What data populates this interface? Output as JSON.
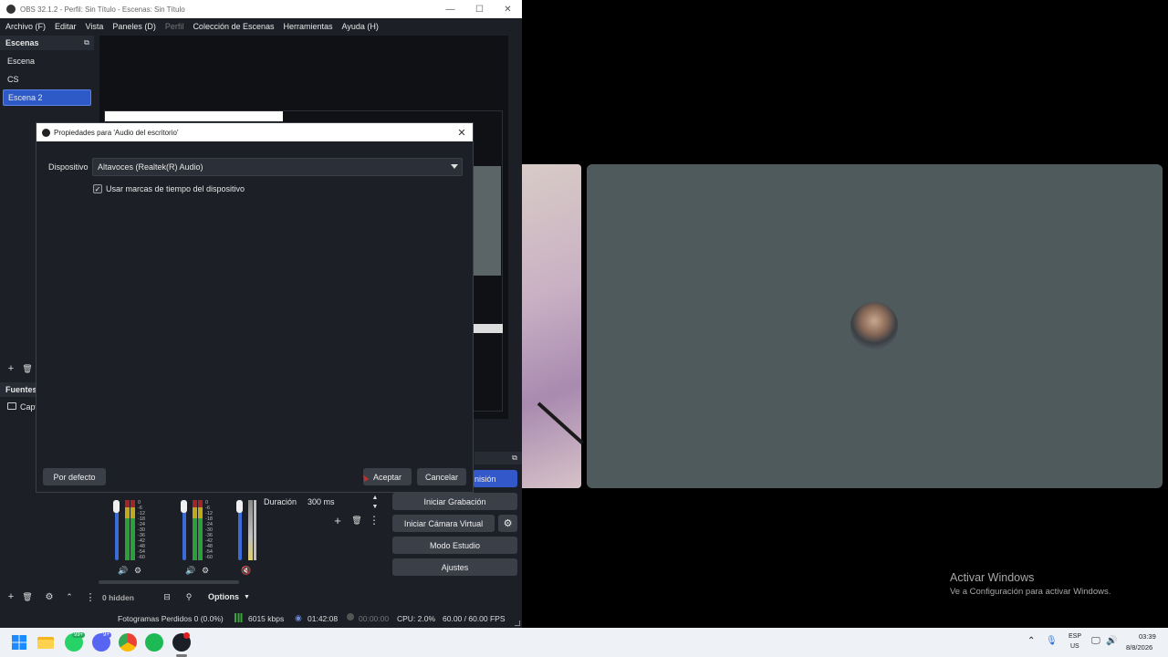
{
  "window": {
    "title": "OBS 32.1.2 - Perfil: Sin Título - Escenas: Sin Título",
    "minimize": "—",
    "maximize": "☐",
    "close": "✕"
  },
  "menu": [
    {
      "label": "Archivo (F)",
      "disabled": false
    },
    {
      "label": "Editar",
      "disabled": false
    },
    {
      "label": "Vista",
      "disabled": false
    },
    {
      "label": "Paneles (D)",
      "disabled": false
    },
    {
      "label": "Perfil",
      "disabled": true
    },
    {
      "label": "Colección de Escenas",
      "disabled": false
    },
    {
      "label": "Herramientas",
      "disabled": false
    },
    {
      "label": "Ayuda (H)",
      "disabled": false
    }
  ],
  "scenes": {
    "title": "Escenas",
    "items": [
      {
        "label": "Escena",
        "selected": false
      },
      {
        "label": "CS",
        "selected": false
      },
      {
        "label": "Escena 2",
        "selected": true
      }
    ]
  },
  "sources": {
    "title": "Fuentes",
    "first_item": "Capt"
  },
  "transitions": {
    "duration_label": "Duración",
    "duration_value": "300 ms"
  },
  "mixer": {
    "hidden_label": "0 hidden",
    "options_label": "Options",
    "db_ticks": [
      "0",
      "-6",
      "-12",
      "-18",
      "-24",
      "-30",
      "-36",
      "-42",
      "-48",
      "-54",
      "-60"
    ]
  },
  "controls": {
    "stream_partial": "nisión",
    "record": "Iniciar Grabación",
    "virtual_cam": "Iniciar Cámara Virtual",
    "studio_mode": "Modo Estudio",
    "settings": "Ajustes"
  },
  "status": {
    "dropped_frames": "Fotogramas Perdidos 0 (0.0%)",
    "bitrate": "6015 kbps",
    "stream_time": "01:42:08",
    "record_time": "00:00:00",
    "cpu": "CPU: 2.0%",
    "fps": "60.00 / 60.00 FPS"
  },
  "dialog": {
    "title": "Propiedades para 'Audio del escritorio'",
    "device_label": "Dispositivo",
    "device_value": "Altavoces (Realtek(R) Audio)",
    "checkbox_label": "Usar marcas de tiempo del dispositivo",
    "checkbox_checked": true,
    "defaults_button": "Por defecto",
    "accept_button": "Aceptar",
    "cancel_button": "Cancelar"
  },
  "watermark": {
    "line1": "Activar Windows",
    "line2": "Ve a Configuración para activar Windows."
  },
  "taskbar": {
    "whatsapp_badge": "99+",
    "discord_badge": "9+",
    "lang_line1": "ESP",
    "lang_line2": "US",
    "time": "03:39",
    "date": "8/8/2026"
  },
  "colors": {
    "accent_blue": "#3358c9",
    "obs_bg": "#1c1f26",
    "call_tile": "#4e5a5c"
  }
}
